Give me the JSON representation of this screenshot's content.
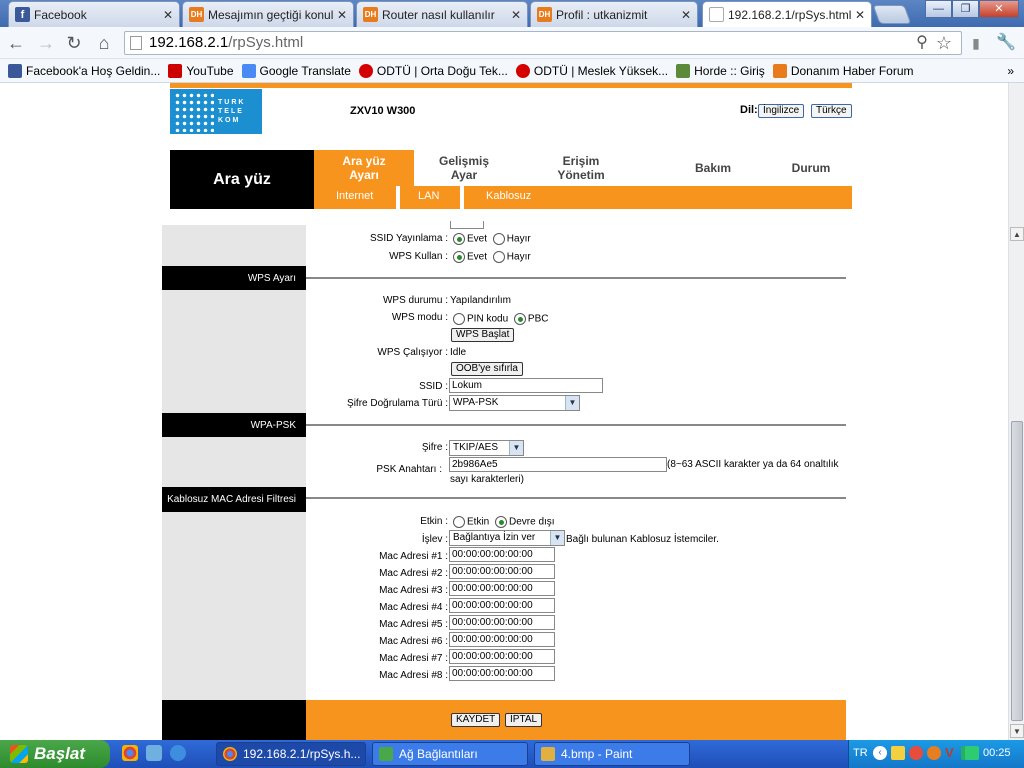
{
  "browser": {
    "tabs": [
      {
        "label": "Facebook",
        "icon": "facebook-icon"
      },
      {
        "label": "Mesajımın geçtiği konular",
        "icon": "dh-icon"
      },
      {
        "label": "Router nasıl kullanılır",
        "icon": "dh-icon"
      },
      {
        "label": "Profil : utkanizmit",
        "icon": "dh-icon"
      },
      {
        "label": "192.168.2.1/rpSys.html",
        "icon": "page-icon"
      }
    ],
    "url_host": "192.168.2.1",
    "url_path": "/rpSys.html",
    "bookmarks": [
      {
        "label": "Facebook'a Hoş Geldin...",
        "color": "#3b5998"
      },
      {
        "label": "YouTube",
        "color": "#cc0000"
      },
      {
        "label": "Google Translate",
        "color": "#4a8af4"
      },
      {
        "label": "ODTÜ | Orta Doğu Tek...",
        "color": "#d40000"
      },
      {
        "label": "ODTÜ | Meslek Yüksek...",
        "color": "#d40000"
      },
      {
        "label": "Horde :: Giriş",
        "color": "#5a8a3a"
      },
      {
        "label": "Donanım Haber Forum",
        "color": "#e87b1c"
      }
    ],
    "more": "»"
  },
  "router": {
    "logo_text": [
      "TURK",
      "TELE",
      "KOM"
    ],
    "model": "ZXV10 W300",
    "lang_label": "Dil:",
    "lang_en": "İngilizce",
    "lang_tr": "Türkçe",
    "brand": "Ara yüz",
    "nav": [
      {
        "label": "Ara yüz Ayarı",
        "active": true
      },
      {
        "label": "Gelişmiş Ayar",
        "active": false
      },
      {
        "label": "Erişim Yönetim",
        "active": false
      },
      {
        "label": "Bakım",
        "active": false
      },
      {
        "label": "Durum",
        "active": false
      }
    ],
    "subnav": [
      "Internet",
      "LAN",
      "Kablosuz"
    ],
    "ssid_broadcast": {
      "label": "SSID Yayınlama :",
      "yes": "Evet",
      "no": "Hayır"
    },
    "wps_use": {
      "label": "WPS Kullan :",
      "yes": "Evet",
      "no": "Hayır"
    },
    "sections": {
      "wps": "WPS Ayarı",
      "wpa": "WPA-PSK",
      "mac": "Kablosuz MAC Adresi Filtresi"
    },
    "wps_status": {
      "label": "WPS durumu :",
      "value": "Yapılandırılım"
    },
    "wps_mode": {
      "label": "WPS modu :",
      "pin": "PIN kodu",
      "pbc": "PBC"
    },
    "wps_start": "WPS Başlat",
    "wps_running": {
      "label": "WPS Çalışıyor :",
      "value": "Idle"
    },
    "oob_reset": "OOB'ye sıfırla",
    "ssid": {
      "label": "SSID :",
      "value": "Lokum"
    },
    "auth_type": {
      "label": "Şifre Doğrulama Türü :",
      "value": "WPA-PSK"
    },
    "cipher": {
      "label": "Şifre :",
      "value": "TKIP/AES"
    },
    "psk": {
      "label": "PSK Anahtarı :",
      "value": "2b986Ae5",
      "hint1": "(8~63 ASCII karakter ya da 64 onaltılık",
      "hint2": "sayı karakterleri)"
    },
    "mac_enable": {
      "label": "Etkin :",
      "on": "Etkin",
      "off": "Devre dışı"
    },
    "mac_action": {
      "label": "İşlev :",
      "value": "Bağlantıya İzin ver",
      "suffix": "Bağlı bulunan Kablosuz İstemciler."
    },
    "mac_addresses": [
      {
        "label": "Mac Adresi #1 :",
        "value": "00:00:00:00:00:00"
      },
      {
        "label": "Mac Adresi #2 :",
        "value": "00:00:00:00:00:00"
      },
      {
        "label": "Mac Adresi #3 :",
        "value": "00:00:00:00:00:00"
      },
      {
        "label": "Mac Adresi #4 :",
        "value": "00:00:00:00:00:00"
      },
      {
        "label": "Mac Adresi #5 :",
        "value": "00:00:00:00:00:00"
      },
      {
        "label": "Mac Adresi #6 :",
        "value": "00:00:00:00:00:00"
      },
      {
        "label": "Mac Adresi #7 :",
        "value": "00:00:00:00:00:00"
      },
      {
        "label": "Mac Adresi #8 :",
        "value": "00:00:00:00:00:00"
      }
    ],
    "save": "KAYDET",
    "cancel": "İPTAL"
  },
  "taskbar": {
    "start": "Başlat",
    "tasks": [
      "192.168.2.1/rpSys.h...",
      "Ağ Bağlantıları",
      "4.bmp - Paint"
    ],
    "lang": "TR",
    "clock": "00:25"
  },
  "colors": {
    "orange": "#f7941d",
    "brand_blue": "#1b8fd0"
  }
}
